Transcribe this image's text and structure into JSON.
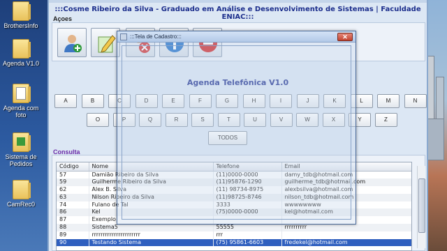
{
  "desktop": {
    "icons": [
      {
        "label": "BrothersInfo"
      },
      {
        "label": "Agenda V1.0"
      },
      {
        "label": "Agenda com foto"
      },
      {
        "label": "Sistema de Pedidos"
      },
      {
        "label": "CamRec0"
      }
    ]
  },
  "main": {
    "banner": ":::Cosme Ribeiro da Silva - Graduado em Análise e Desenvolvimento de Sistemas | Faculdade ENIAC:::",
    "actions_label": "Açoes",
    "app_title": "Agenda Telefônica V1.0",
    "keyboard": {
      "row1": [
        "A",
        "B",
        "C",
        "D",
        "E",
        "F",
        "G",
        "H",
        "I",
        "J",
        "K",
        "L",
        "M",
        "N"
      ],
      "row2": [
        "O",
        "P",
        "Q",
        "R",
        "S",
        "T",
        "U",
        "V",
        "W",
        "X",
        "Y",
        "Z"
      ],
      "all": "TODOS"
    },
    "consulta_label": "Consulta",
    "table": {
      "headers": [
        "Código",
        "Nome",
        "Telefone",
        "Email"
      ],
      "rows": [
        [
          "57",
          "Damião Ribeiro da Silva",
          "(11)0000-0000",
          "damy_tdb@hotmail.com"
        ],
        [
          "59",
          "Guilherme Ribeiro da Silva",
          "(11)95876-1290",
          "guilherme_tdb@hotmail.com"
        ],
        [
          "62",
          "Alex B. Silva",
          "(11) 98734-8975",
          "alexbsilva@hotmail.com"
        ],
        [
          "63",
          "Nilson Ribeiro da Silva",
          "(11)98725-8746",
          "nilson_tdb@hotmail.com"
        ],
        [
          "74",
          "Fulano de Tal",
          "3333",
          "wwwwwwww"
        ],
        [
          "86",
          "Kel",
          "(75)0000-0000",
          "kel@hotmail.com"
        ],
        [
          "87",
          "Exemplo",
          "",
          ""
        ],
        [
          "88",
          "Sistema5",
          "55555",
          "rrrrrrrrrr"
        ],
        [
          "89",
          "rrrrrrrrrrrrrrrrrrrrrr",
          "rrr",
          ""
        ],
        [
          "90",
          "Testando Sistema",
          "(75) 95861-6603",
          "fredekel@hotmail.com"
        ]
      ],
      "selected_code": "90"
    }
  },
  "dialog": {
    "title": ":::Tela de Cadastro:::",
    "close_label": "✕"
  }
}
